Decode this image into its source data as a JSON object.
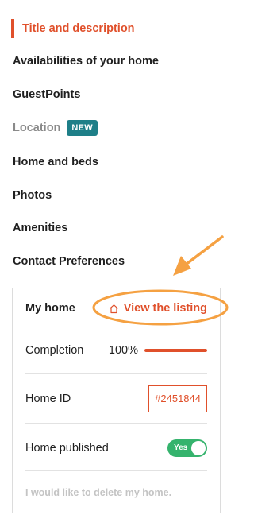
{
  "nav": {
    "items": [
      {
        "label": "Title and description",
        "state": "active"
      },
      {
        "label": "Availabilities of your home",
        "state": "normal"
      },
      {
        "label": "GuestPoints",
        "state": "normal"
      },
      {
        "label": "Location",
        "state": "muted",
        "badge": "NEW"
      },
      {
        "label": "Home and beds",
        "state": "normal"
      },
      {
        "label": "Photos",
        "state": "normal"
      },
      {
        "label": "Amenities",
        "state": "normal"
      },
      {
        "label": "Contact Preferences",
        "state": "normal"
      }
    ]
  },
  "card": {
    "title": "My home",
    "view_link": "View the listing",
    "completion_label": "Completion",
    "completion_value": "100%",
    "completion_fraction": 1.0,
    "home_id_label": "Home ID",
    "home_id_value": "#2451844",
    "published_label": "Home published",
    "published_toggle": "Yes",
    "delete_link": "I would like to delete my home."
  },
  "colors": {
    "accent": "#e0502b",
    "badge": "#1e7f88",
    "toggle_on": "#35b36d",
    "annotation": "#f5a142"
  },
  "icons": {
    "view_link_icon": "home-outline-icon"
  }
}
